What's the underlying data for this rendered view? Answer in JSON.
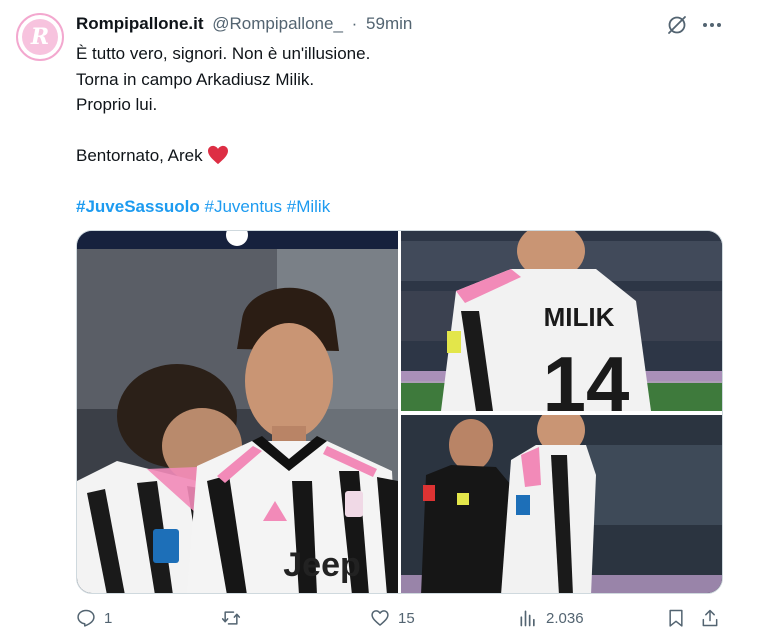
{
  "author": {
    "name": "Rompipallone.it",
    "handle": "@Rompipallone_",
    "separator": "·",
    "time": "59min",
    "avatar_letter": "R"
  },
  "tweet": {
    "lines": [
      "È tutto vero, signori. Non è un'illusione.",
      "Torna in campo Arkadiusz Milik.",
      "Proprio lui.",
      "Bentornato, Arek"
    ],
    "hashtags": [
      "#JuveSassuolo",
      "#Juventus",
      "#Milik"
    ]
  },
  "media": {
    "photo1_text": "Jeep",
    "photo2_text": "MILIK"
  },
  "actions": {
    "replies": "1",
    "retweets": "",
    "likes": "15",
    "views": "2.036"
  },
  "colors": {
    "accent": "#1d9bf0",
    "muted": "#536471",
    "heart": "#e0245e"
  },
  "icons": [
    "grok-icon",
    "more-icon",
    "reply-icon",
    "retweet-icon",
    "like-icon",
    "views-icon",
    "bookmark-icon",
    "share-icon",
    "heart-emoji"
  ]
}
